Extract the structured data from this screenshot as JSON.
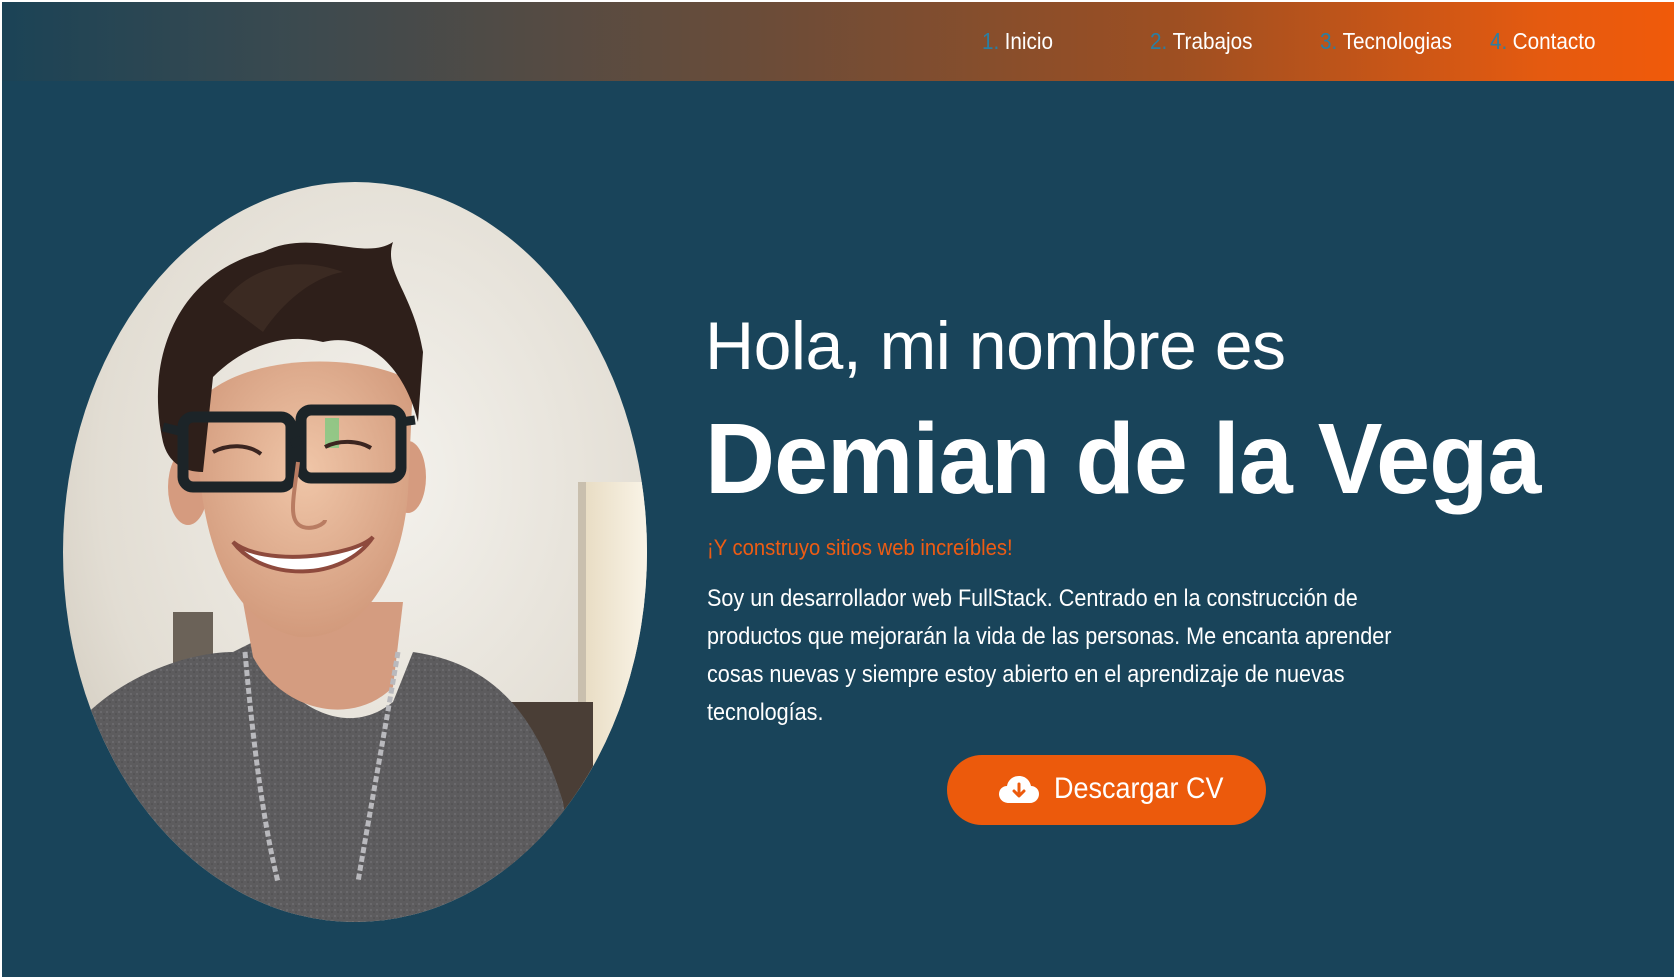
{
  "nav": {
    "items": [
      {
        "num": "1.",
        "label": "Inicio"
      },
      {
        "num": "2.",
        "label": "Trabajos"
      },
      {
        "num": "3.",
        "label": "Tecnologias"
      },
      {
        "num": "4.",
        "label": "Contacto"
      }
    ]
  },
  "hero": {
    "greeting": "Hola, mi nombre es",
    "name": "Demian de la Vega",
    "tagline": "¡Y construyo sitios web increíbles!",
    "bio": "Soy un desarrollador web FullStack. Centrado en la construcción de productos que mejorarán la vida de las personas. Me encanta aprender cosas nuevas y siempre estoy abierto en el aprendizaje de nuevas tecnologías.",
    "button": {
      "label": "Descargar CV",
      "icon": "cloud-download-icon"
    }
  },
  "colors": {
    "background": "#19445a",
    "accent": "#ec5a0c",
    "nav_number": "#2a7fa3",
    "text": "#ffffff"
  }
}
